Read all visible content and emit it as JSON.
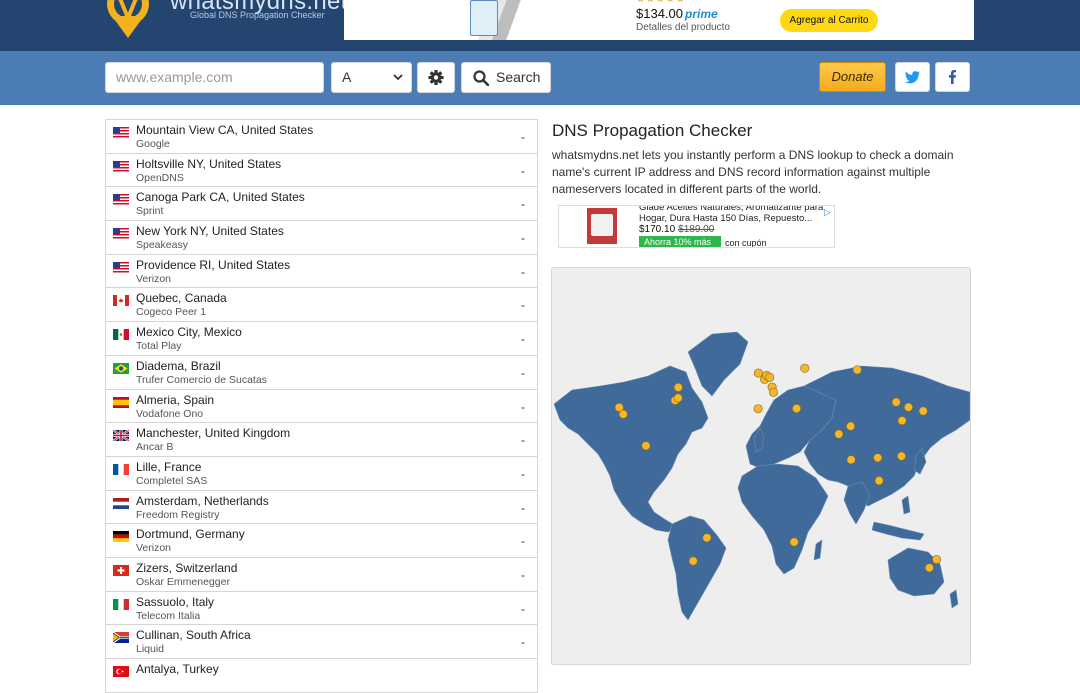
{
  "header": {
    "logo_text": "whatsmydns.net",
    "logo_subtitle": "Global DNS Propagation Checker",
    "ad": {
      "price": "$134.00",
      "prime": "prime",
      "details": "Detalles del producto",
      "cart_button": "Agregar al Carrito"
    }
  },
  "search": {
    "placeholder": "www.example.com",
    "record_type": "A",
    "search_label": "Search",
    "donate_label": "Donate"
  },
  "servers": [
    {
      "location": "Mountain View CA, United States",
      "provider": "Google",
      "flag": "us",
      "result": "-"
    },
    {
      "location": "Holtsville NY, United States",
      "provider": "OpenDNS",
      "flag": "us",
      "result": "-"
    },
    {
      "location": "Canoga Park CA, United States",
      "provider": "Sprint",
      "flag": "us",
      "result": "-"
    },
    {
      "location": "New York NY, United States",
      "provider": "Speakeasy",
      "flag": "us",
      "result": "-"
    },
    {
      "location": "Providence RI, United States",
      "provider": "Verizon",
      "flag": "us",
      "result": "-"
    },
    {
      "location": "Quebec, Canada",
      "provider": "Cogeco Peer 1",
      "flag": "ca",
      "result": "-"
    },
    {
      "location": "Mexico City, Mexico",
      "provider": "Total Play",
      "flag": "mx",
      "result": "-"
    },
    {
      "location": "Diadema, Brazil",
      "provider": "Trufer Comercio de Sucatas",
      "flag": "br",
      "result": "-"
    },
    {
      "location": "Almeria, Spain",
      "provider": "Vodafone Ono",
      "flag": "es",
      "result": "-"
    },
    {
      "location": "Manchester, United Kingdom",
      "provider": "Ancar B",
      "flag": "gb",
      "result": "-"
    },
    {
      "location": "Lille, France",
      "provider": "Completel SAS",
      "flag": "fr",
      "result": "-"
    },
    {
      "location": "Amsterdam, Netherlands",
      "provider": "Freedom Registry",
      "flag": "nl",
      "result": "-"
    },
    {
      "location": "Dortmund, Germany",
      "provider": "Verizon",
      "flag": "de",
      "result": "-"
    },
    {
      "location": "Zizers, Switzerland",
      "provider": "Oskar Emmenegger",
      "flag": "ch",
      "result": "-"
    },
    {
      "location": "Sassuolo, Italy",
      "provider": "Telecom Italia",
      "flag": "it",
      "result": "-"
    },
    {
      "location": "Cullinan, South Africa",
      "provider": "Liquid",
      "flag": "za",
      "result": "-"
    },
    {
      "location": "Antalya, Turkey",
      "provider": "",
      "flag": "tr",
      "result": ""
    }
  ],
  "main": {
    "title": "DNS Propagation Checker",
    "description": "whatsmydns.net lets you instantly perform a DNS lookup to check a domain name's current IP address and DNS record information against multiple nameservers located in different parts of the world."
  },
  "ad2": {
    "title": "Glade Aceites Naturales, Aromatizante para Hogar, Dura Hasta 150 Días, Repuesto...",
    "price": "$170.10",
    "old_price": "$189.00",
    "save": "Ahorra 10% más",
    "coupon": "con cupón"
  },
  "colors": {
    "header_bg": "#24456f",
    "search_bg": "#4b7cb3",
    "map_land": "#3f6a99",
    "map_marker": "#f4b62a",
    "donate": "#f5ab1c"
  },
  "map_markers": [
    {
      "name": "Mountain View",
      "lat": 37.4,
      "lon": -122.1
    },
    {
      "name": "Canoga Park",
      "lat": 34.2,
      "lon": -118.6
    },
    {
      "name": "Holtsville",
      "lat": 40.8,
      "lon": -73.0
    },
    {
      "name": "New York",
      "lat": 40.7,
      "lon": -74.0
    },
    {
      "name": "Providence",
      "lat": 41.8,
      "lon": -71.4
    },
    {
      "name": "Quebec",
      "lat": 46.8,
      "lon": -71.2
    },
    {
      "name": "Mexico City",
      "lat": 19.4,
      "lon": -99.1
    },
    {
      "name": "Diadema",
      "lat": -23.7,
      "lon": -46.6
    },
    {
      "name": "Almeria",
      "lat": 36.8,
      "lon": -2.5
    },
    {
      "name": "Manchester",
      "lat": 53.5,
      "lon": -2.2
    },
    {
      "name": "Lille",
      "lat": 50.6,
      "lon": 3.1
    },
    {
      "name": "Amsterdam",
      "lat": 52.4,
      "lon": 4.9
    },
    {
      "name": "Dortmund",
      "lat": 51.5,
      "lon": 7.5
    },
    {
      "name": "Zizers",
      "lat": 46.9,
      "lon": 9.6
    },
    {
      "name": "Sassuolo",
      "lat": 44.5,
      "lon": 10.8
    },
    {
      "name": "Cullinan",
      "lat": -25.7,
      "lon": 28.5
    },
    {
      "name": "Antalya",
      "lat": 36.9,
      "lon": 30.7
    },
    {
      "name": "Moscow",
      "lat": 55.8,
      "lon": 37.6
    },
    {
      "name": "Novosibirsk",
      "lat": 55.0,
      "lon": 82.9
    },
    {
      "name": "Karachi",
      "lat": 24.9,
      "lon": 67.0
    },
    {
      "name": "Delhi",
      "lat": 28.6,
      "lon": 77.2
    },
    {
      "name": "Bangalore",
      "lat": 12.9,
      "lon": 77.6
    },
    {
      "name": "Beijing",
      "lat": 39.9,
      "lon": 116.4
    },
    {
      "name": "Shanghai",
      "lat": 31.2,
      "lon": 121.5
    },
    {
      "name": "Seoul",
      "lat": 37.5,
      "lon": 127.0
    },
    {
      "name": "Tokyo",
      "lat": 35.7,
      "lon": 139.7
    },
    {
      "name": "Bangkok",
      "lat": 13.8,
      "lon": 100.5
    },
    {
      "name": "Kuala Lumpur",
      "lat": 3.1,
      "lon": 101.7
    },
    {
      "name": "Manila",
      "lat": 14.6,
      "lon": 121.0
    },
    {
      "name": "Sydney",
      "lat": -33.9,
      "lon": 151.2
    },
    {
      "name": "Melbourne",
      "lat": -37.8,
      "lon": 145.0
    },
    {
      "name": "Buenos Aires",
      "lat": -34.6,
      "lon": -58.4
    }
  ]
}
